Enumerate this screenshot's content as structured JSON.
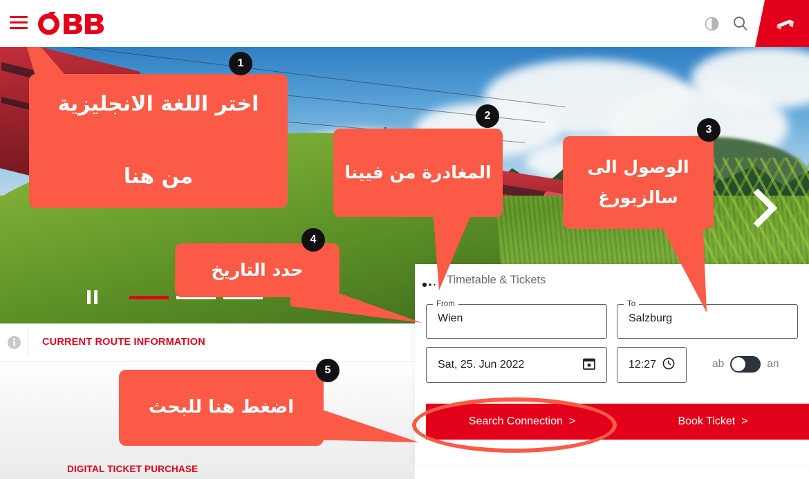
{
  "header": {
    "menu_icon": "hamburger-menu-icon",
    "brand": "ÖBB",
    "contrast_icon": "contrast-toggle-icon",
    "search_icon": "search-icon",
    "ticket_icon": "ticket-icon"
  },
  "hero": {
    "next_icon": "chevron-right-icon",
    "pause_icon": "pause-icon",
    "slides": [
      {
        "active": true
      },
      {
        "active": false
      },
      {
        "active": false
      }
    ]
  },
  "route_info": {
    "info_icon": "info-circle-icon",
    "label": "CURRENT ROUTE INFORMATION"
  },
  "footer": {
    "digital_ticket_label": "DIGITAL TICKET PURCHASE"
  },
  "booking": {
    "title": "Timetable & Tickets",
    "title_icon": "dots-icon",
    "from": {
      "label": "From",
      "value": "Wien",
      "placeholder": "From"
    },
    "to": {
      "label": "To",
      "value": "Salzburg",
      "placeholder": "To"
    },
    "date": {
      "value": "Sat, 25. Jun 2022",
      "icon": "calendar-icon"
    },
    "time": {
      "value": "12:27",
      "icon": "clock-icon"
    },
    "direction_toggle": {
      "left_label": "ab",
      "right_label": "an",
      "state": "ab"
    },
    "search_button": {
      "label": "Search Connection",
      "chevron": ">"
    },
    "book_button": {
      "label": "Book Ticket",
      "chevron": ">"
    }
  },
  "annotations": {
    "accent_color": "#FA5A46",
    "badge_color": "#111114",
    "brand_red": "#E2001A",
    "callouts": [
      {
        "number": "1",
        "text": "اختر اللغة الانجليزية\n\nمن هنا"
      },
      {
        "number": "2",
        "text": "المغادرة من فيينا"
      },
      {
        "number": "3",
        "text": "الوصول الى سالزبورغ"
      },
      {
        "number": "4",
        "text": "حدد التاريخ"
      },
      {
        "number": "5",
        "text": "اضغط هنا للبحث"
      }
    ]
  }
}
